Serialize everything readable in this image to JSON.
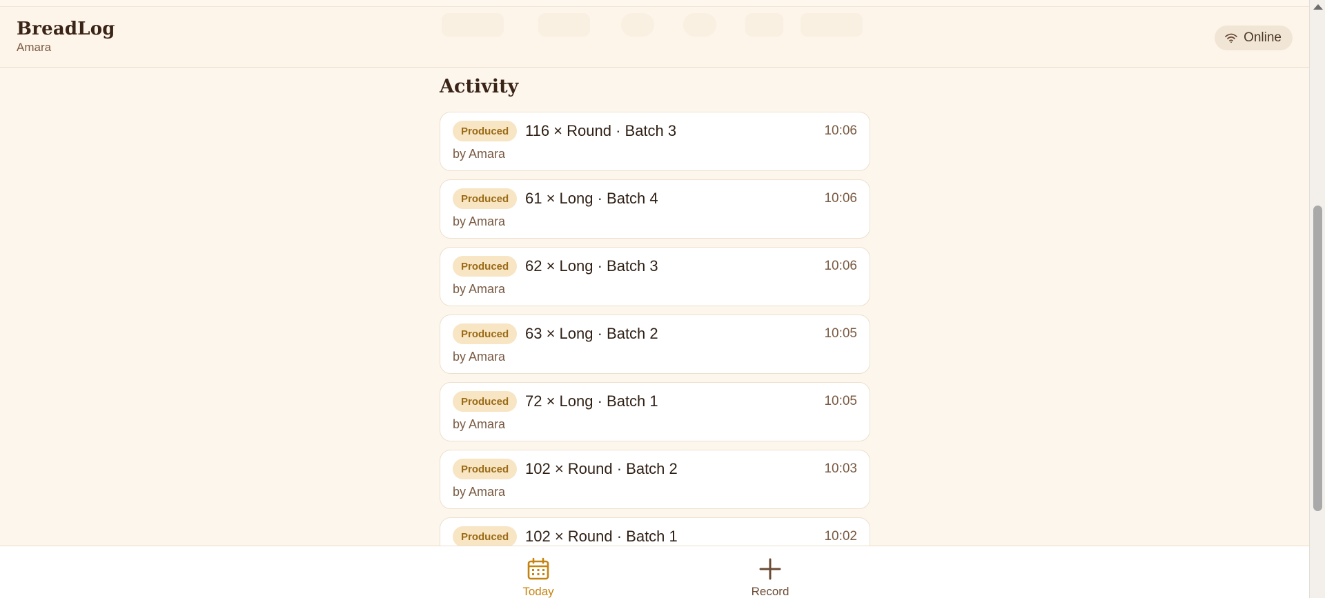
{
  "header": {
    "app_title": "BreadLog",
    "user_name": "Amara",
    "status": {
      "label": "Online",
      "icon": "wifi-icon"
    }
  },
  "activity": {
    "title": "Activity",
    "items": [
      {
        "badge": "Produced",
        "title": "116 × Round · Batch 3",
        "time": "10:06",
        "by": "by Amara"
      },
      {
        "badge": "Produced",
        "title": "61 × Long · Batch 4",
        "time": "10:06",
        "by": "by Amara"
      },
      {
        "badge": "Produced",
        "title": "62 × Long · Batch 3",
        "time": "10:06",
        "by": "by Amara"
      },
      {
        "badge": "Produced",
        "title": "63 × Long · Batch 2",
        "time": "10:05",
        "by": "by Amara"
      },
      {
        "badge": "Produced",
        "title": "72 × Long · Batch 1",
        "time": "10:05",
        "by": "by Amara"
      },
      {
        "badge": "Produced",
        "title": "102 × Round · Batch 2",
        "time": "10:03",
        "by": "by Amara"
      },
      {
        "badge": "Produced",
        "title": "102 × Round · Batch 1",
        "time": "10:02",
        "by": ""
      }
    ]
  },
  "nav": {
    "today": {
      "label": "Today",
      "icon": "calendar-icon",
      "active": true
    },
    "record": {
      "label": "Record",
      "icon": "plus-icon",
      "active": false
    }
  },
  "colors": {
    "background": "#fcf6ec",
    "accent": "#c4830f",
    "badge_bg": "#f7e5c4",
    "badge_text": "#9a6a15",
    "text_dark": "#3a2417",
    "text_muted": "#7a5b44"
  }
}
